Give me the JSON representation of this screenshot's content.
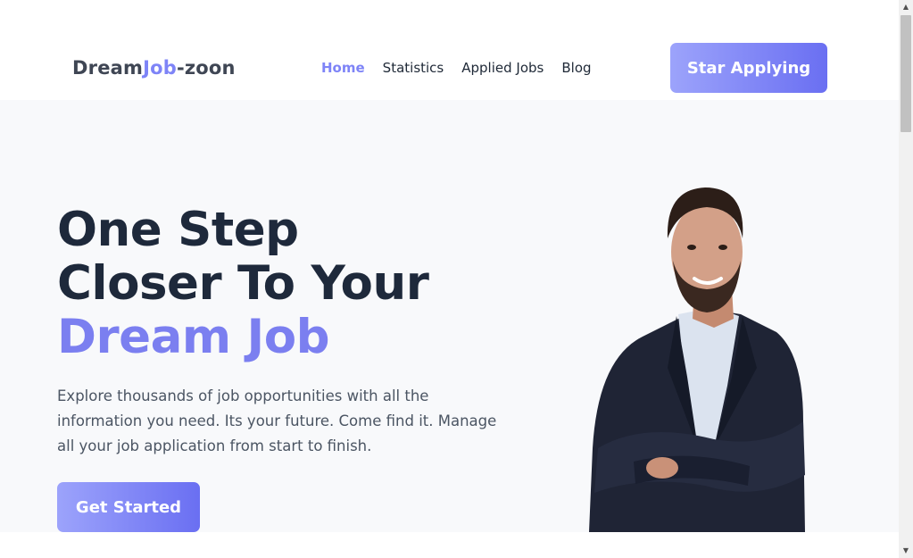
{
  "header": {
    "logo": {
      "part1": "Dream",
      "part2": "Job",
      "part3": "-zoon"
    },
    "nav": [
      {
        "label": "Home",
        "active": true
      },
      {
        "label": "Statistics",
        "active": false
      },
      {
        "label": "Applied Jobs",
        "active": false
      },
      {
        "label": "Blog",
        "active": false
      }
    ],
    "cta_label": "Star Applying"
  },
  "hero": {
    "title_line1": "One Step",
    "title_line2": "Closer To Your",
    "title_line3": "Dream Job",
    "description": "Explore thousands of job opportunities with all the information you need. Its your future. Come find it. Manage all your job application from start to finish.",
    "button_label": "Get Started"
  },
  "colors": {
    "accent": "#7e84f7",
    "gradient_start": "#9ca3fb",
    "gradient_end": "#6a6ff2",
    "hero_bg": "#f8f9fb",
    "text_dark": "#1e293b"
  },
  "icons": {
    "scroll_up": "triangle-up-icon",
    "scroll_down": "triangle-down-icon"
  }
}
